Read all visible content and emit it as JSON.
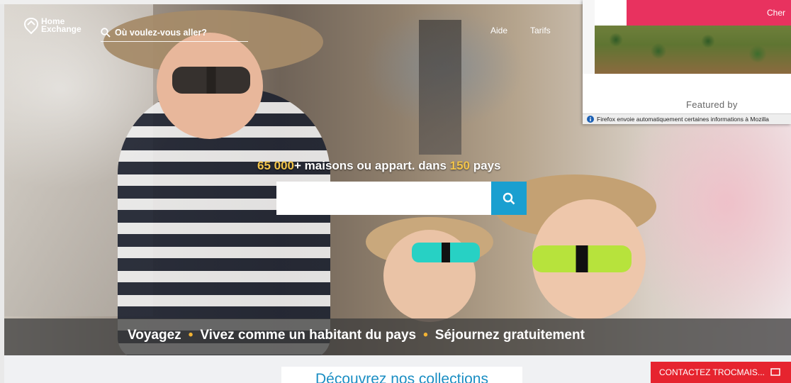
{
  "header": {
    "logo_line1": "Home",
    "logo_line2": "Exchange",
    "search_placeholder": "Où voulez-vous aller?",
    "nav": [
      "Aide",
      "Tarifs"
    ]
  },
  "hero": {
    "tagline_count": "65 000",
    "tagline_mid": "+ maisons ou appart. dans ",
    "tagline_countries": "150",
    "tagline_end": " pays",
    "search_value": "",
    "band": {
      "item1": "Voyagez",
      "item2": "Vivez comme un habitant du pays",
      "item3": "Séjournez gratuitement",
      "separator": "•"
    }
  },
  "popup": {
    "cta_label": "Cher",
    "featured_by": "Featured by",
    "infobar_text": "Firefox envoie automatiquement certaines informations à Mozilla"
  },
  "footer": {
    "collections_title": "Découvrez nos collections",
    "contact_label": "CONTACTEZ TROCMAIS..."
  },
  "colors": {
    "accent_blue": "#1a9fd0",
    "highlight_yellow": "#f2c44a",
    "popup_pink": "#e8325f",
    "contact_red": "#e6242f"
  }
}
